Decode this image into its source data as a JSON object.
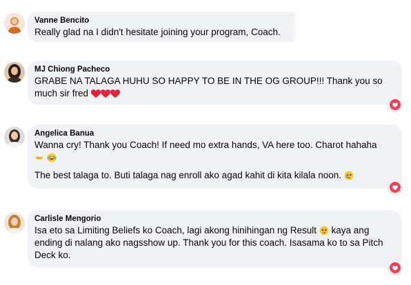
{
  "comments": [
    {
      "author": "Vanne Bencito",
      "lines": [
        "Really glad na I didn't hesitate joining your program, Coach."
      ]
    },
    {
      "author": "MJ Chiong Pacheco",
      "lines": [
        "GRABE NA TALAGA HUHU SO HAPPY TO BE IN THE OG GROUP!!! Thank you so",
        "much sir fred"
      ],
      "trailing_emoji": [
        "red-heart",
        "red-heart",
        "red-heart"
      ],
      "reaction": "heart-reaction-icon"
    },
    {
      "author": "Angelica Banua",
      "lines": [
        "Wanna cry! Thank you Coach! If need mo extra hands, VA here too. Charot hahaha"
      ],
      "emoji_line": [
        "handshake",
        "laughing-tears"
      ],
      "second_paragraph": "The best talaga to. Buti talaga nag enroll ako agad kahit di kita kilala noon.",
      "second_paragraph_emoji": "crying-face",
      "reaction": "heart-reaction-icon"
    },
    {
      "author": "Carlisle Mengorio",
      "line1": "Isa eto sa Limiting Beliefs ko Coach, lagi akong hinihingan ng Result",
      "line1_emoji": "sad-face",
      "line1_after": "kaya ang",
      "line2": "ending di nalang ako nagsshow up. Thank you for this coach. Isasama ko to sa Pitch",
      "line3": "Deck ko.",
      "reaction": "heart-reaction-icon"
    }
  ],
  "colors": {
    "bubble": "#f0f2f5",
    "text": "#050505",
    "heart": "#f33e58"
  }
}
